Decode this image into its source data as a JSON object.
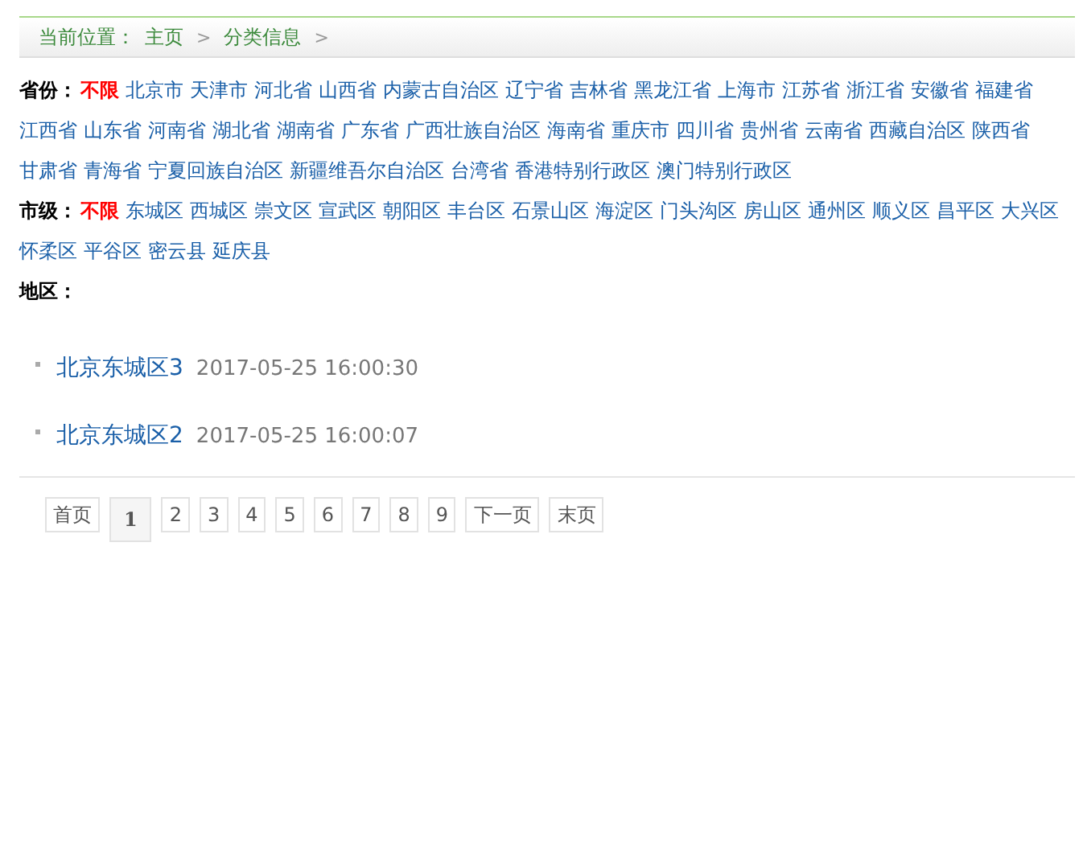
{
  "breadcrumb": {
    "label": "当前位置：",
    "items": [
      "主页",
      "分类信息"
    ],
    "separator": ">"
  },
  "filters": [
    {
      "label": "省份：",
      "options": [
        {
          "text": "不限",
          "selected": true
        },
        {
          "text": "北京市",
          "selected": false
        },
        {
          "text": "天津市",
          "selected": false
        },
        {
          "text": "河北省",
          "selected": false
        },
        {
          "text": "山西省",
          "selected": false
        },
        {
          "text": "内蒙古自治区",
          "selected": false
        },
        {
          "text": "辽宁省",
          "selected": false
        },
        {
          "text": "吉林省",
          "selected": false
        },
        {
          "text": "黑龙江省",
          "selected": false
        },
        {
          "text": "上海市",
          "selected": false
        },
        {
          "text": "江苏省",
          "selected": false
        },
        {
          "text": "浙江省",
          "selected": false
        },
        {
          "text": "安徽省",
          "selected": false
        },
        {
          "text": "福建省",
          "selected": false
        },
        {
          "text": "江西省",
          "selected": false
        },
        {
          "text": "山东省",
          "selected": false
        },
        {
          "text": "河南省",
          "selected": false
        },
        {
          "text": "湖北省",
          "selected": false
        },
        {
          "text": "湖南省",
          "selected": false
        },
        {
          "text": "广东省",
          "selected": false
        },
        {
          "text": "广西壮族自治区",
          "selected": false
        },
        {
          "text": "海南省",
          "selected": false
        },
        {
          "text": "重庆市",
          "selected": false
        },
        {
          "text": "四川省",
          "selected": false
        },
        {
          "text": "贵州省",
          "selected": false
        },
        {
          "text": "云南省",
          "selected": false
        },
        {
          "text": "西藏自治区",
          "selected": false
        },
        {
          "text": "陕西省",
          "selected": false
        },
        {
          "text": "甘肃省",
          "selected": false
        },
        {
          "text": "青海省",
          "selected": false
        },
        {
          "text": "宁夏回族自治区",
          "selected": false
        },
        {
          "text": "新疆维吾尔自治区",
          "selected": false
        },
        {
          "text": "台湾省",
          "selected": false
        },
        {
          "text": "香港特别行政区",
          "selected": false
        },
        {
          "text": "澳门特别行政区",
          "selected": false
        }
      ]
    },
    {
      "label": "市级：",
      "options": [
        {
          "text": "不限",
          "selected": true
        },
        {
          "text": "东城区",
          "selected": false
        },
        {
          "text": "西城区",
          "selected": false
        },
        {
          "text": "崇文区",
          "selected": false
        },
        {
          "text": "宣武区",
          "selected": false
        },
        {
          "text": "朝阳区",
          "selected": false
        },
        {
          "text": "丰台区",
          "selected": false
        },
        {
          "text": "石景山区",
          "selected": false
        },
        {
          "text": "海淀区",
          "selected": false
        },
        {
          "text": "门头沟区",
          "selected": false
        },
        {
          "text": "房山区",
          "selected": false
        },
        {
          "text": "通州区",
          "selected": false
        },
        {
          "text": "顺义区",
          "selected": false
        },
        {
          "text": "昌平区",
          "selected": false
        },
        {
          "text": "大兴区",
          "selected": false
        },
        {
          "text": "怀柔区",
          "selected": false
        },
        {
          "text": "平谷区",
          "selected": false
        },
        {
          "text": "密云县",
          "selected": false
        },
        {
          "text": "延庆县",
          "selected": false
        }
      ]
    },
    {
      "label": "地区："
    }
  ],
  "listings": [
    {
      "title": "北京东城区3",
      "date": "2017-05-25 16:00:30"
    },
    {
      "title": "北京东城区2",
      "date": "2017-05-25 16:00:07"
    }
  ],
  "pagination": [
    {
      "label": "首页",
      "selected": false
    },
    {
      "label": "1",
      "selected": true
    },
    {
      "label": "2",
      "selected": false
    },
    {
      "label": "3",
      "selected": false
    },
    {
      "label": "4",
      "selected": false
    },
    {
      "label": "5",
      "selected": false
    },
    {
      "label": "6",
      "selected": false
    },
    {
      "label": "7",
      "selected": false
    },
    {
      "label": "8",
      "selected": false
    },
    {
      "label": "9",
      "selected": false
    },
    {
      "label": "下一页",
      "selected": false
    },
    {
      "label": "末页",
      "selected": false
    }
  ]
}
